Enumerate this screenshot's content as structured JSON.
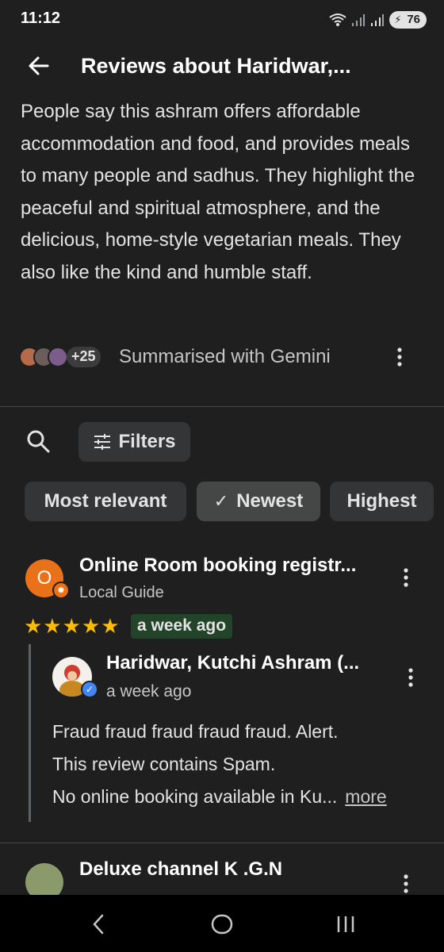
{
  "status_bar": {
    "time": "11:12",
    "battery": "76",
    "icons": [
      "wifi-icon",
      "signal-icon",
      "signal-icon",
      "battery-icon"
    ]
  },
  "app_bar": {
    "title": "Reviews about Haridwar,...",
    "back_icon": "arrow-left-icon"
  },
  "summary": {
    "text": "People say this ashram offers affordable accommodation and food, and provides meals to many people and sadhus. They highlight the peaceful and spiritual atmosphere, and the delicious, home-style vegetarian meals. They also like the kind and humble staff."
  },
  "gemini": {
    "extra_count": "+25",
    "label": "Summarised with Gemini"
  },
  "filters": {
    "label": "Filters"
  },
  "sort_chips": [
    {
      "label": "Most relevant",
      "selected": false
    },
    {
      "label": "Newest",
      "selected": true
    },
    {
      "label": "Highest",
      "selected": false
    }
  ],
  "reviews": [
    {
      "avatar_letter": "O",
      "name": "Online Room booking registr...",
      "subtitle": "Local Guide",
      "rating": 5,
      "stars": "★★★★★",
      "date": "a week ago",
      "reply": {
        "name": "Haridwar, Kutchi Ashram (...",
        "date": "a week ago",
        "lines": [
          "Fraud fraud fraud fraud fraud.  Alert.",
          "This review contains Spam.",
          "No online booking available in Ku..."
        ],
        "more_label": "more"
      }
    },
    {
      "name": "Deluxe channel K .G.N"
    }
  ],
  "colors": {
    "background": "#1f1f1f",
    "chip": "#333537",
    "star": "#fbbc04",
    "date_badge": "#22452a",
    "avatar_orange": "#e8711a",
    "verified_blue": "#4285f4"
  }
}
